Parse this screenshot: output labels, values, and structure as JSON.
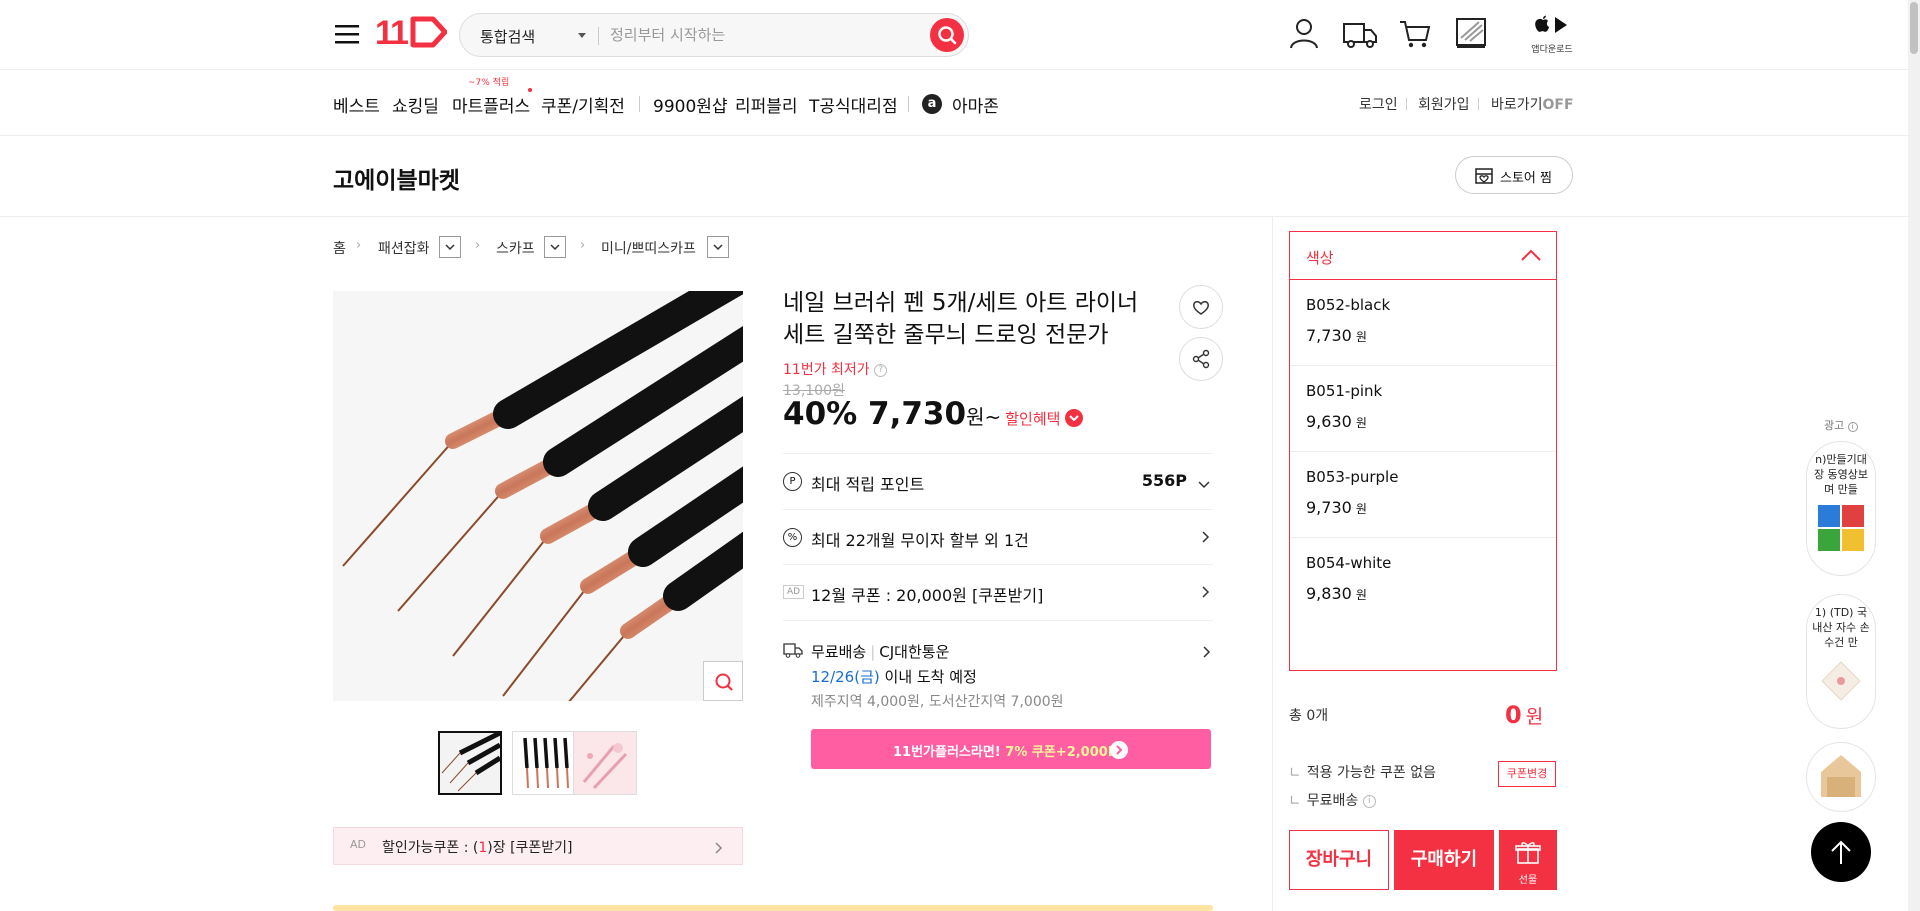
{
  "header": {
    "logo": "11",
    "search_category": "통합검색",
    "search_placeholder": "정리부터 시작하는",
    "app_download": "앱다운로드"
  },
  "nav": {
    "items": [
      "베스트",
      "쇼킹딜",
      "마트플러스",
      "쿠폰/기획전",
      "9900원샵",
      "리퍼블리",
      "T공식대리점",
      "아마존"
    ],
    "mart_badge": "~7% 적립",
    "amazon_logo": "a",
    "login": "로그인",
    "signup": "회원가입",
    "shortcut": "바로가기",
    "shortcut_state": "OFF"
  },
  "store": {
    "name": "고에이블마켓",
    "follow_label": "스토어 찜"
  },
  "breadcrumb": [
    "홈",
    "패션잡화",
    "스카프",
    "미니/쁘띠스카프"
  ],
  "product": {
    "title": "네일 브러쉬 펜 5개/세트 아트 라이너 세트 길쭉한 줄무늬 드로잉 전문가",
    "lowest_label": "11번가 최저가",
    "original_price": "13,100원",
    "discount": "40%",
    "price": "7,730",
    "price_unit": "원~",
    "benefit_label": "할인혜택",
    "points_label": "최대 적립 포인트",
    "points_value": "556P",
    "installment": "최대 22개월 무이자 할부 외 1건",
    "ad_tag": "AD",
    "coupon_ad": "12월 쿠폰 : 20,000원 [쿠폰받기]",
    "shipping_type": "무료배송",
    "courier": "CJ대한통운",
    "arrival_date": "12/26(금)",
    "arrival_text": "이내 도착 예정",
    "extra_fee": "제주지역 4,000원, 도서산간지역 7,000원",
    "plus_banner_prefix": "11번가플러스라면!",
    "plus_banner_highlight": "7% 쿠폰+2,000P",
    "ad_coupon_label": "AD",
    "ad_coupon_text_pre": "할인가능쿠폰 : (",
    "ad_coupon_count": "1",
    "ad_coupon_text_post": ")장 [쿠폰받기]"
  },
  "options": {
    "header": "색상",
    "items": [
      {
        "name": "B052-black",
        "price": "7,730",
        "unit": "원"
      },
      {
        "name": "B051-pink",
        "price": "9,630",
        "unit": "원"
      },
      {
        "name": "B053-purple",
        "price": "9,730",
        "unit": "원"
      },
      {
        "name": "B054-white",
        "price": "9,830",
        "unit": "원"
      }
    ]
  },
  "order": {
    "total_label": "총 0개",
    "total_price": "0",
    "total_unit": "원",
    "coupon_status": "적용 가능한 쿠폰 없음",
    "coupon_change": "쿠폰변경",
    "free_shipping": "무료배송",
    "cart": "장바구니",
    "buy": "구매하기",
    "gift": "선물"
  },
  "side_ads": {
    "label": "광고",
    "ad1": "n)만들기대장 동영상보며 만들",
    "ad2": "1) (TD) 국내산 자수 손수건 만"
  },
  "colors": {
    "brand": "#f43142",
    "plus_banner": "#ff5fa2",
    "arrival_blue": "#1a6bd6"
  }
}
